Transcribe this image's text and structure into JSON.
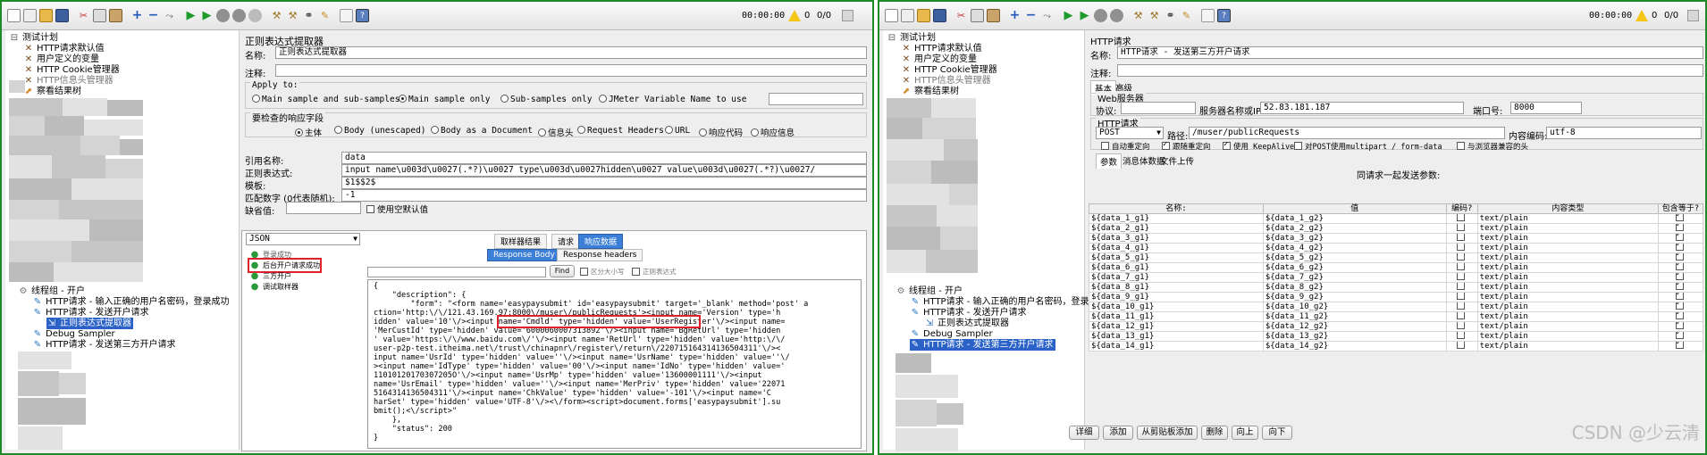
{
  "left": {
    "toolbar": {
      "timer": "00:00:00",
      "warn_count": "0",
      "thread_ratio": "0/0"
    },
    "tree": {
      "items": [
        {
          "label": "测试计划"
        },
        {
          "label": "HTTP请求默认值"
        },
        {
          "label": "用户定义的变量"
        },
        {
          "label": "HTTP Cookie管理器"
        },
        {
          "label": "HTTP信息头管理器"
        },
        {
          "label": "察看结果树"
        }
      ],
      "lower_items": [
        {
          "label": "线程组 - 开户"
        },
        {
          "label": "HTTP请求 - 输入正确的用户名密码，登录成功"
        },
        {
          "label": "HTTP请求 - 发送开户请求"
        },
        {
          "label": "正则表达式提取器"
        },
        {
          "label": "Debug Sampler"
        },
        {
          "label": "HTTP请求 - 发送第三方开户请求"
        }
      ]
    },
    "form": {
      "title": "正则表达式提取器",
      "name_label": "名称:",
      "name_value": "正则表达式提取器",
      "comment_label": "注释:",
      "comment_value": "",
      "apply_to_label": "Apply to:",
      "apply_options": [
        "Main sample and sub-samples",
        "Main sample only",
        "Sub-samples only",
        "JMeter Variable Name to use"
      ],
      "apply_selected": "Main sample only",
      "check_label": "要检查的响应字段",
      "check_options": [
        "主体",
        "Body (unescaped)",
        "Body as a Document",
        "信息头",
        "Request Headers",
        "URL",
        "响应代码",
        "响应信息"
      ],
      "check_selected": "主体",
      "ref_label": "引用名称:",
      "ref_value": "data",
      "regex_label": "正则表达式:",
      "regex_value": "input name\\u003d\\u0027(.*?)\\u0027 type\\u003d\\u0027hidden\\u0027 value\\u003d\\u0027(.*?)\\u0027/",
      "template_label": "模板:",
      "template_value": "$1$$2$",
      "match_label": "匹配数字 (0代表随机):",
      "match_value": "-1",
      "default_label": "缺省值:",
      "default_value": "",
      "use_empty_label": "使用空默认值"
    },
    "results": {
      "renderer": "JSON",
      "tabs": [
        "取样器结果",
        "请求",
        "响应数据"
      ],
      "active_tab": "响应数据",
      "subtabs": [
        "Response Body",
        "Response headers"
      ],
      "active_subtab": "Response Body",
      "find_label": "Find",
      "find_opts": [
        "区分大小写",
        "正则表达式"
      ],
      "items": [
        "登录成功",
        "后台开户请求成功",
        "三方开户",
        "调试取样器"
      ],
      "highlighted_item": "后台开户请求成功",
      "body_lines": [
        "{",
        "    \"description\": {",
        "        \"form\": \"<form name='easypaysubmit' id='easypaysubmit' target='_blank' method='post' a",
        "ction='http:\\/\\/121.43.169.97:8000\\/muser\\/publicRequests'><input name='Version' type='h",
        "idden' value='10'\\/><input name='Cmdld' type='hidden' value='UserRegister'\\/><input name=",
        "'MerCustId' type='hidden' value='6000060007313892'\\/><input name='BgRetUrl' type='hidden",
        "' value='https:\\/\\/www.baidu.com\\/'\\/><input name='RetUrl' type='hidden' value='http:\\/\\/",
        "user-p2p-test.itheima.net\\/trust\\/chinapnr\\/register\\/return\\/220715164314136504311'\\/><",
        "input name='UsrId' type='hidden' value=''\\/><input name='UsrName' type='hidden' value=''\\/",
        "><input name='IdType' type='hidden' value='00'\\/><input name='IdNo' type='hidden' value='",
        "11010120170307205O'\\/><input name='UsrMp' type='hidden' value='13600001111'\\/><input",
        "name='UsrEmail' type='hidden' value=''\\/><input name='MerPriv' type='hidden' value='22071",
        "5164314136504311'\\/><input name='ChkValue' type='hidden' value='-101'\\/><input name='C",
        "harSet' type='hidden' value='UTF-8'\\/><\\/form><script>document.forms['easypaysubmit'].su",
        "bmit();<\\/script>\"",
        "    },",
        "    \"status\": 200",
        "}"
      ]
    }
  },
  "right": {
    "toolbar": {
      "timer": "00:00:00",
      "warn_count": "0",
      "thread_ratio": "0/0"
    },
    "tree": {
      "items": [
        {
          "label": "测试计划"
        },
        {
          "label": "HTTP请求默认值"
        },
        {
          "label": "用户定义的变量"
        },
        {
          "label": "HTTP Cookie管理器"
        },
        {
          "label": "HTTP信息头管理器"
        },
        {
          "label": "察看结果树"
        }
      ],
      "lower_items": [
        {
          "label": "线程组 - 开户"
        },
        {
          "label": "HTTP请求 - 输入正确的用户名密码，登录成功"
        },
        {
          "label": "HTTP请求 - 发送开户请求"
        },
        {
          "label": "正则表达式提取器"
        },
        {
          "label": "Debug Sampler"
        },
        {
          "label": "HTTP请求 - 发送第三方开户请求"
        }
      ]
    },
    "form": {
      "title": "HTTP请求",
      "name_label": "名称:",
      "name_value": "HTTP请求 - 发送第三方开户请求",
      "comment_label": "注释:",
      "tabs": [
        "基本",
        "高级"
      ],
      "web_server_label": "Web服务器",
      "protocol_label": "协议:",
      "protocol_value": "",
      "server_label": "服务器名称或IP:",
      "server_value": "52.83.181.187",
      "port_label": "端口号:",
      "port_value": "8000",
      "http_request_label": "HTTP请求",
      "method_value": "POST",
      "path_label": "路径:",
      "path_value": "/muser/publicRequests",
      "encoding_label": "内容编码:",
      "encoding_value": "utf-8",
      "checkboxes": [
        {
          "label": "自动重定向",
          "checked": false
        },
        {
          "label": "跟随重定向",
          "checked": true
        },
        {
          "label": "使用 KeepAlive",
          "checked": true
        },
        {
          "label": "对POST使用multipart / form-data",
          "checked": false
        },
        {
          "label": "与浏览器兼容的头",
          "checked": false
        }
      ],
      "param_tabs": [
        "参数",
        "消息体数据",
        "文件上传"
      ],
      "send_params_label": "同请求一起发送参数:",
      "columns": [
        "名称:",
        "值",
        "编码?",
        "内容类型",
        "包含等于?"
      ],
      "rows": [
        {
          "name": "${data_1_g1}",
          "value": "${data_1_g2}",
          "type": "text/plain"
        },
        {
          "name": "${data_2_g1}",
          "value": "${data_2_g2}",
          "type": "text/plain"
        },
        {
          "name": "${data_3_g1}",
          "value": "${data_3_g2}",
          "type": "text/plain"
        },
        {
          "name": "${data_4_g1}",
          "value": "${data_4_g2}",
          "type": "text/plain"
        },
        {
          "name": "${data_5_g1}",
          "value": "${data_5_g2}",
          "type": "text/plain"
        },
        {
          "name": "${data_6_g1}",
          "value": "${data_6_g2}",
          "type": "text/plain"
        },
        {
          "name": "${data_7_g1}",
          "value": "${data_7_g2}",
          "type": "text/plain"
        },
        {
          "name": "${data_8_g1}",
          "value": "${data_8_g2}",
          "type": "text/plain"
        },
        {
          "name": "${data_9_g1}",
          "value": "${data_9_g2}",
          "type": "text/plain"
        },
        {
          "name": "${data_10_g1}",
          "value": "${data_10_g2}",
          "type": "text/plain"
        },
        {
          "name": "${data_11_g1}",
          "value": "${data_11_g2}",
          "type": "text/plain"
        },
        {
          "name": "${data_12_g1}",
          "value": "${data_12_g2}",
          "type": "text/plain"
        },
        {
          "name": "${data_13_g1}",
          "value": "${data_13_g2}",
          "type": "text/plain"
        },
        {
          "name": "${data_14_g1}",
          "value": "${data_14_g2}",
          "type": "text/plain"
        }
      ],
      "buttons": [
        "详细",
        "添加",
        "从剪贴板添加",
        "删除",
        "向上",
        "向下"
      ]
    },
    "watermark": "CSDN @少云清"
  }
}
